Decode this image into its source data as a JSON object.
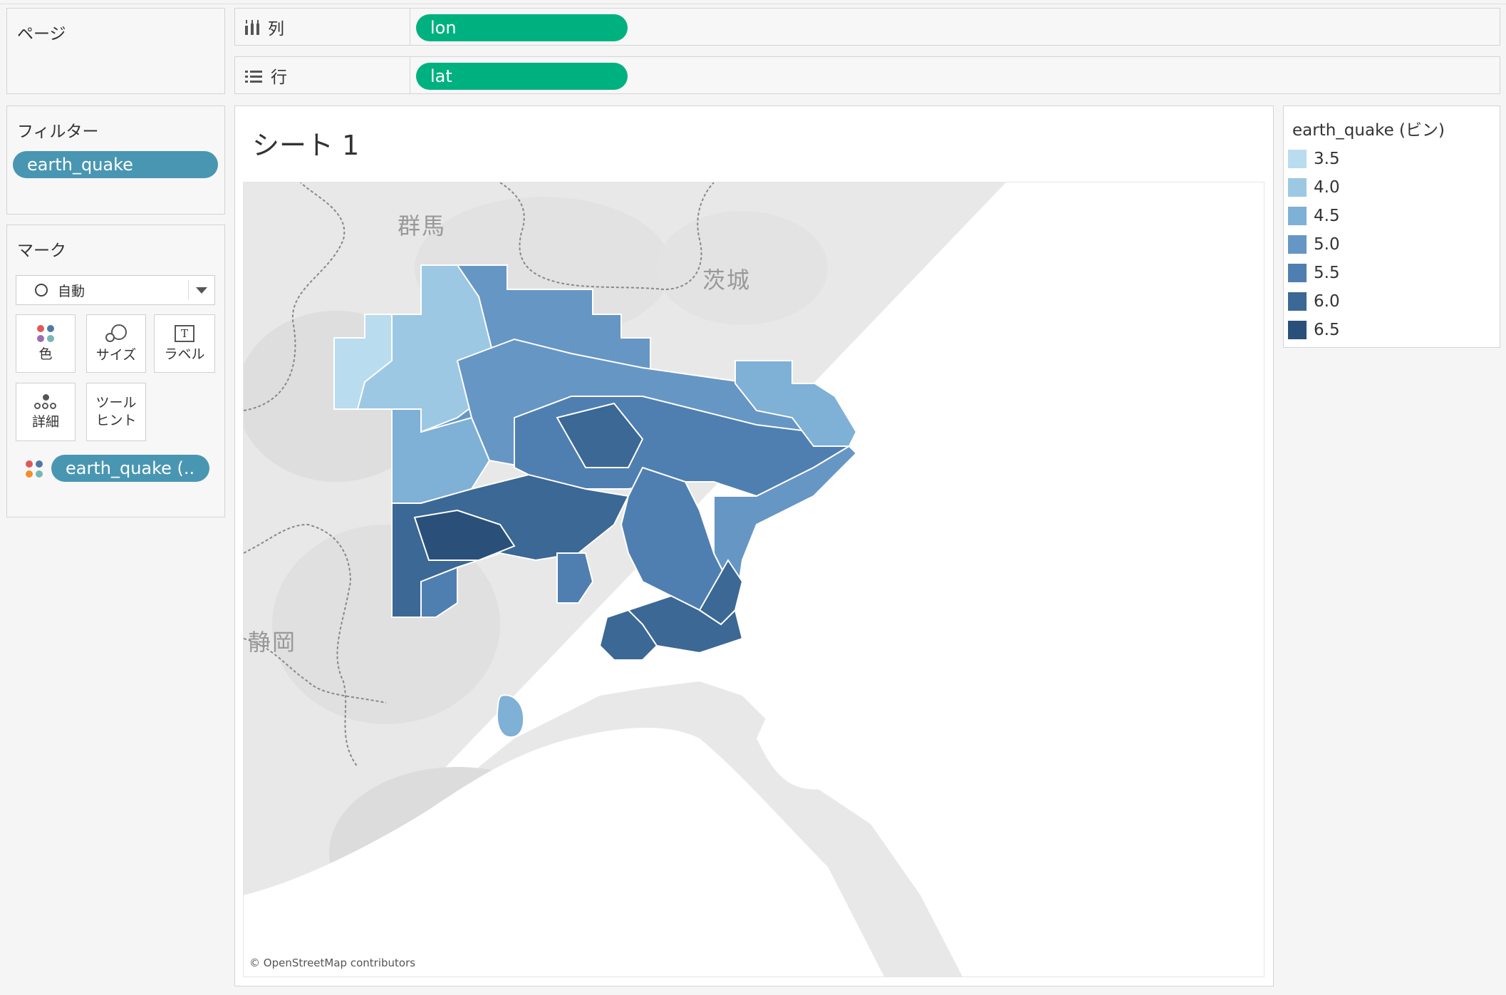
{
  "pages": {
    "title": "ページ"
  },
  "columns": {
    "label": "列",
    "field": "lon"
  },
  "rows": {
    "label": "行",
    "field": "lat"
  },
  "filters": {
    "title": "フィルター",
    "field": "earth_quake"
  },
  "marks": {
    "title": "マーク",
    "type": "自動",
    "buttons": {
      "color": "色",
      "size": "サイズ",
      "label": "ラベル",
      "detail": "詳細",
      "tooltip_line1": "ツール",
      "tooltip_line2": "ヒント"
    },
    "field": "earth_quake (.."
  },
  "sheet": {
    "title": "シート 1"
  },
  "map": {
    "labels": {
      "gunma": "群馬",
      "ibaraki": "茨城",
      "shizuoka": "静岡"
    },
    "attribution": "© OpenStreetMap contributors"
  },
  "legend": {
    "title": "earth_quake (ビン)",
    "items": [
      {
        "label": "3.5",
        "color": "#b9dcef"
      },
      {
        "label": "4.0",
        "color": "#9cc8e4"
      },
      {
        "label": "4.5",
        "color": "#7fb0d6"
      },
      {
        "label": "5.0",
        "color": "#6696c4"
      },
      {
        "label": "5.5",
        "color": "#4f7fb0"
      },
      {
        "label": "6.0",
        "color": "#3b6894"
      },
      {
        "label": "6.5",
        "color": "#2a507a"
      }
    ]
  }
}
